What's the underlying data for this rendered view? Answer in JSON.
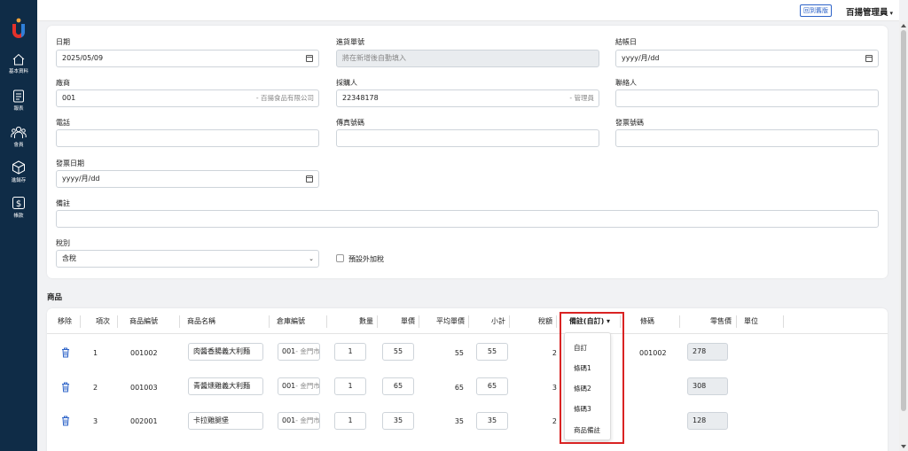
{
  "sidebar": {
    "items": [
      {
        "icon": "home-icon",
        "label": "基本資料"
      },
      {
        "icon": "report-icon",
        "label": "報表"
      },
      {
        "icon": "members-icon",
        "label": "會員"
      },
      {
        "icon": "box-icon",
        "label": "進銷存"
      },
      {
        "icon": "dollar-icon",
        "label": "帳款"
      }
    ],
    "brand_color": "#0f2c47",
    "logo_colors": [
      "#f2a33a",
      "#e4322b",
      "#2f7fd8"
    ]
  },
  "header": {
    "old_version_label": "回到舊版",
    "user_name": "百揚管理員"
  },
  "form": {
    "date_label": "日期",
    "date_value": "2025/05/09",
    "voucher_label": "進貨單號",
    "voucher_placeholder": "將在新增後自動填入",
    "closing_label": "結帳日",
    "closing_value": "yyyy/月/dd",
    "vendor_label": "廠商",
    "vendor_code": "001",
    "vendor_name": "- 百揚食品有限公司",
    "buyer_label": "採購人",
    "buyer_code": "22348178",
    "buyer_name": "- 管理員",
    "contact_label": "聯絡人",
    "phone_label": "電話",
    "fax_label": "傳真號碼",
    "invoice_no_label": "發票號碼",
    "invoice_date_label": "發票日期",
    "invoice_date_value": "yyyy/月/dd",
    "note_label": "備註",
    "tax_label": "稅別",
    "tax_value": "含稅",
    "tax_extra_label": "預設外加稅"
  },
  "products": {
    "section_title": "商品",
    "columns": {
      "remove": "移除",
      "item": "項次",
      "code": "商品編號",
      "name": "商品名稱",
      "warehouse": "倉庫編號",
      "qty": "數量",
      "price": "單價",
      "avg": "平均單價",
      "subtotal": "小計",
      "tax": "稅額",
      "note": "備註(自訂)",
      "barcode": "條碼",
      "retail": "零售價",
      "unit": "單位"
    },
    "note_caret": "▾",
    "rows": [
      {
        "item": "1",
        "code": "001002",
        "name": "肉醬香腸義大利麵",
        "warehouse": "001",
        "warehouse_hint": "- 金門市",
        "qty": "1",
        "price": "55",
        "avg": "55",
        "subtotal": "55",
        "tax": "2",
        "barcode": "001002",
        "retail": "278"
      },
      {
        "item": "2",
        "code": "001003",
        "name": "青醬燻雞義大利麵",
        "warehouse": "001",
        "warehouse_hint": "- 金門市",
        "qty": "1",
        "price": "65",
        "avg": "65",
        "subtotal": "65",
        "tax": "3",
        "barcode": "",
        "retail": "308"
      },
      {
        "item": "3",
        "code": "002001",
        "name": "卡拉雞腿堡",
        "warehouse": "001",
        "warehouse_hint": "- 金門市",
        "qty": "1",
        "price": "35",
        "avg": "35",
        "subtotal": "35",
        "tax": "2",
        "barcode": "",
        "retail": "128"
      }
    ],
    "dropdown": [
      "自訂",
      "條碼1",
      "條碼2",
      "條碼3",
      "商品備註"
    ],
    "highlight_color": "#d92323"
  }
}
